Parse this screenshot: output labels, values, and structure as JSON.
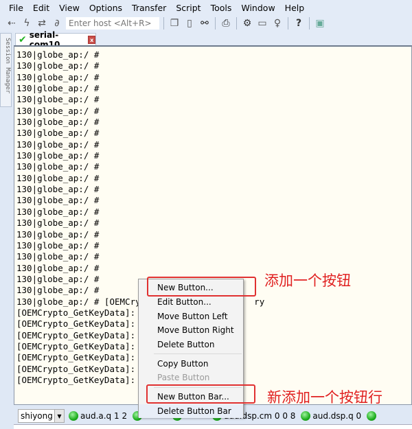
{
  "menu": [
    "File",
    "Edit",
    "View",
    "Options",
    "Transfer",
    "Script",
    "Tools",
    "Window",
    "Help"
  ],
  "toolbar": {
    "host_placeholder": "Enter host <Alt+R>",
    "icons": [
      "connect-icon",
      "lightning-icon",
      "reconnect-icon",
      "disconnect-icon",
      "copy-icon",
      "paste-icon",
      "find-binoculars-icon",
      "print-icon",
      "settings-gear-icon",
      "keymap-icon",
      "key-icon",
      "help-icon",
      "sftp-icon"
    ]
  },
  "session_manager": "Session Manager",
  "tab": {
    "label": "serial-com10",
    "status_color": "#22b222"
  },
  "terminal": {
    "lines": [
      "130|globe_ap:/ #",
      "130|globe_ap:/ #",
      "130|globe_ap:/ #",
      "130|globe_ap:/ #",
      "130|globe_ap:/ #",
      "130|globe_ap:/ #",
      "130|globe_ap:/ #",
      "130|globe_ap:/ #",
      "130|globe_ap:/ #",
      "130|globe_ap:/ #",
      "130|globe_ap:/ #",
      "130|globe_ap:/ #",
      "130|globe_ap:/ #",
      "130|globe_ap:/ #",
      "130|globe_ap:/ #",
      "130|globe_ap:/ #",
      "130|globe_ap:/ #",
      "130|globe_ap:/ #",
      "130|globe_ap:/ #",
      "130|globe_ap:/ #",
      "130|globe_ap:/ #",
      "130|globe_ap:/ #",
      "130|globe_ap:/ # [OEMCry                      ry",
      "[OEMCrypto_GetKeyData]:",
      "[OEMCrypto_GetKeyData]:",
      "[OEMCrypto_GetKeyData]:",
      "[OEMCrypto_GetKeyData]:",
      "[OEMCrypto_GetKeyData]:",
      "[OEMCrypto_GetKeyData]:",
      "[OEMCrypto_GetKeyData]:"
    ]
  },
  "button_bar": {
    "session": "shiyong",
    "buttons": [
      "aud.a.q 1 2",
      "",
      "",
      "aud.dsp.cm 0 0 8",
      "aud.dsp.q 0",
      ""
    ]
  },
  "context_menu": {
    "items": [
      {
        "label": "New Button...",
        "enabled": true
      },
      {
        "label": "Edit Button...",
        "enabled": true
      },
      {
        "label": "Move Button Left",
        "enabled": true
      },
      {
        "label": "Move Button Right",
        "enabled": true
      },
      {
        "label": "Delete Button",
        "enabled": true
      },
      {
        "label": "Copy Button",
        "enabled": true
      },
      {
        "label": "Paste Button",
        "enabled": false
      },
      {
        "label": "New Button Bar...",
        "enabled": true
      },
      {
        "label": "Delete Button Bar",
        "enabled": true
      }
    ]
  },
  "annotations": {
    "new_button": "添加一个按钮",
    "new_button_bar": "新添加一个按钮行",
    "color": "#e02020"
  }
}
